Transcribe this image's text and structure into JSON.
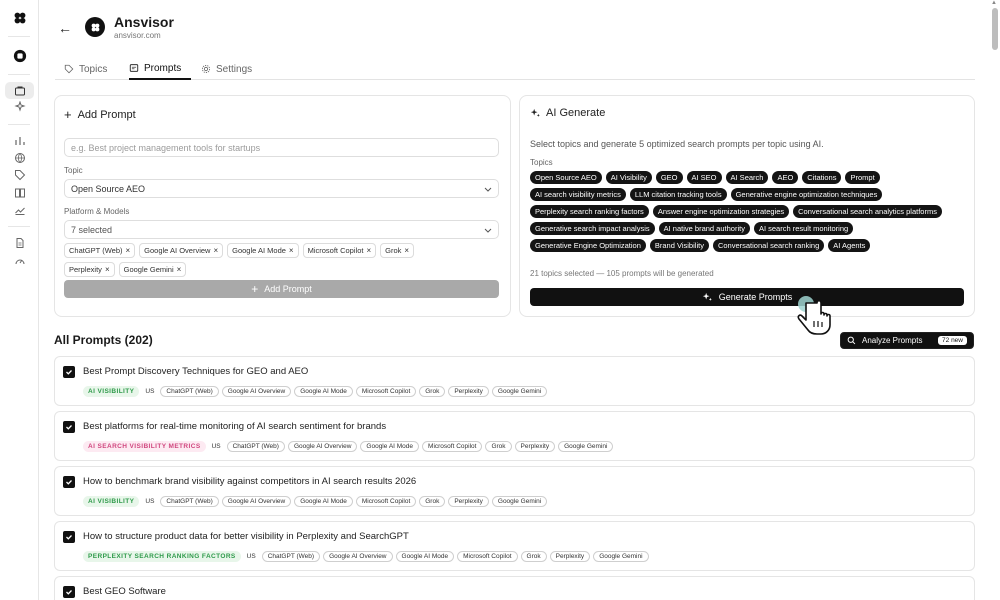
{
  "brand": {
    "name": "Ansvisor",
    "url": "ansvisor.com"
  },
  "tabs": [
    {
      "label": "Topics"
    },
    {
      "label": "Prompts"
    },
    {
      "label": "Settings"
    }
  ],
  "add_prompt": {
    "title": "Add Prompt",
    "prompt_placeholder": "e.g. Best project management tools for startups",
    "topic_label": "Topic",
    "topic_value": "Open Source AEO",
    "platform_label": "Platform & Models",
    "platform_value": "7 selected",
    "models": [
      "ChatGPT (Web)",
      "Google AI Overview",
      "Google AI Mode",
      "Microsoft Copilot",
      "Grok",
      "Perplexity",
      "Google Gemini"
    ],
    "button_label": "Add Prompt"
  },
  "ai_generate": {
    "title": "AI Generate",
    "description": "Select topics and generate 5 optimized search prompts per topic using AI.",
    "topics_label": "Topics",
    "topics": [
      "Open Source AEO",
      "AI Visibility",
      "GEO",
      "AI SEO",
      "AI Search",
      "AEO",
      "Citations",
      "Prompt",
      "AI search visibility metrics",
      "LLM citation tracking tools",
      "Generative engine optimization techniques",
      "Perplexity search ranking factors",
      "Answer engine optimization strategies",
      "Conversational search analytics platforms",
      "Generative search impact analysis",
      "AI native brand authority",
      "AI search result monitoring",
      "Generative Engine Optimization",
      "Brand Visibility",
      "Conversational search ranking",
      "AI Agents"
    ],
    "summary": "21 topics selected — 105 prompts will be generated",
    "button_label": "Generate Prompts"
  },
  "all_prompts": {
    "title": "All Prompts (202)",
    "analyze_label": "Analyze Prompts",
    "analyze_badge": "72 new",
    "rows": [
      {
        "title": "Best Prompt Discovery Techniques for GEO and AEO",
        "category": "AI VISIBILITY",
        "color": "green",
        "country": "US"
      },
      {
        "title": "Best platforms for real-time monitoring of AI search sentiment for brands",
        "category": "AI SEARCH VISIBILITY METRICS",
        "color": "pink",
        "country": "US"
      },
      {
        "title": "How to benchmark brand visibility against competitors in AI search results 2026",
        "category": "AI VISIBILITY",
        "color": "green",
        "country": "US"
      },
      {
        "title": "How to structure product data for better visibility in Perplexity and SearchGPT",
        "category": "PERPLEXITY SEARCH RANKING FACTORS",
        "color": "green",
        "country": "US"
      },
      {
        "title": "Best GEO Software",
        "category": "",
        "color": "green",
        "country": ""
      }
    ],
    "row_models": [
      "ChatGPT (Web)",
      "Google AI Overview",
      "Google AI Mode",
      "Microsoft Copilot",
      "Grok",
      "Perplexity",
      "Google Gemini"
    ]
  },
  "colors": {
    "accent": "#111111",
    "green_tag": "#2e9a4a",
    "pink_tag": "#d0467e",
    "add_button": "#a9a9a9"
  }
}
